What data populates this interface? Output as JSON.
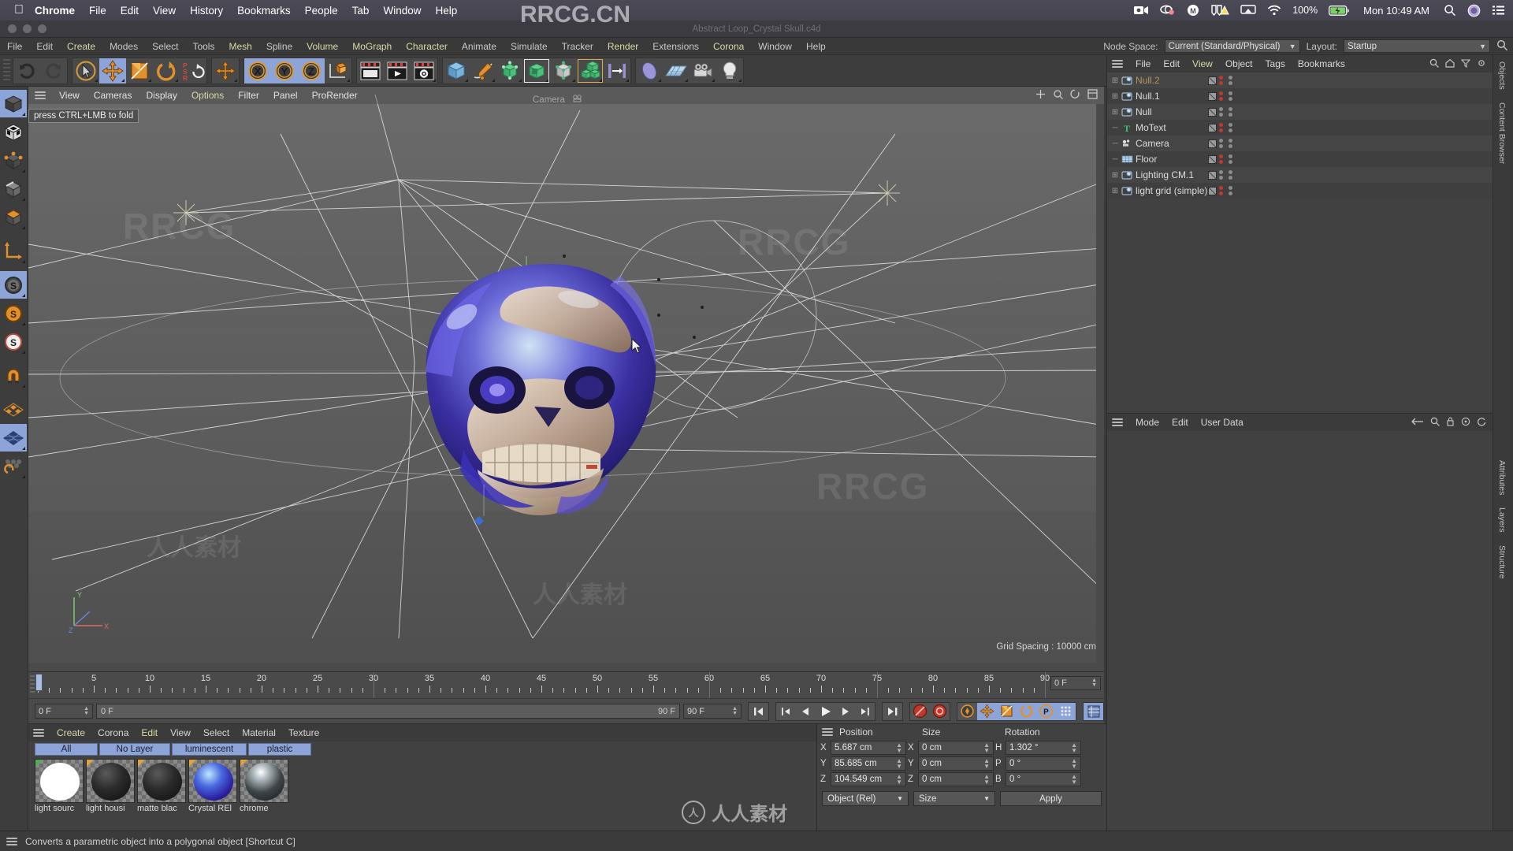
{
  "macos": {
    "app_name": "Chrome",
    "menus": [
      "Chrome",
      "File",
      "Edit",
      "View",
      "History",
      "Bookmarks",
      "People",
      "Tab",
      "Window",
      "Help"
    ],
    "battery_percent": "100%",
    "clock": "Mon 10:49 AM",
    "tray_icons": [
      "screen-record-icon",
      "dropbox-icon",
      "grammarly-icon",
      "display-warning-icon",
      "airplay-icon",
      "wifi-icon",
      "battery-icon",
      "search-icon",
      "siri-icon",
      "control-center-icon"
    ]
  },
  "window": {
    "title": "Abstract Loop_Crystal Skull.c4d"
  },
  "c4d_menu": {
    "items": [
      "File",
      "Edit",
      "Create",
      "Modes",
      "Select",
      "Tools",
      "Mesh",
      "Spline",
      "Volume",
      "MoGraph",
      "Character",
      "Animate",
      "Simulate",
      "Tracker",
      "Render",
      "Extensions",
      "Corona",
      "Window",
      "Help"
    ],
    "node_space_label": "Node Space:",
    "node_space_value": "Current (Standard/Physical)",
    "layout_label": "Layout:",
    "layout_value": "Startup"
  },
  "toolbar": {
    "groups": [
      {
        "name": "undo-redo",
        "buttons": [
          "undo-icon",
          "redo-icon"
        ]
      },
      {
        "name": "transform",
        "buttons": [
          "selection-icon",
          "move-icon",
          "scale-icon",
          "rotate-icon",
          "psr-icon"
        ]
      },
      {
        "name": "world-object",
        "buttons": [
          "world-object-axis-icon"
        ]
      },
      {
        "name": "axis-lock",
        "buttons": [
          "lock-x-icon",
          "lock-y-icon",
          "lock-z-icon",
          "world-coord-icon"
        ]
      },
      {
        "name": "render",
        "buttons": [
          "render-view-icon",
          "render-queue-icon",
          "render-settings-icon"
        ]
      },
      {
        "name": "create",
        "buttons": [
          "cube-icon",
          "spline-pen-icon",
          "nurbs-icon",
          "modeling-object-icon",
          "deformer-icon",
          "array-icon",
          "scene-icon"
        ]
      },
      {
        "name": "scene",
        "buttons": [
          "field-icon",
          "floor-icon",
          "camera-icon",
          "light-icon"
        ]
      }
    ]
  },
  "left_palette": {
    "tools": [
      "model-mode-icon",
      "texture-mode-icon",
      "points-mode-icon",
      "edges-mode-icon",
      "polygons-mode-icon",
      "axis-mode-icon",
      "enable-axis-icon",
      "snap-gray-icon",
      "snap-orange-icon",
      "snap-white-icon",
      "magnet-icon",
      "workplane-icon",
      "grid-lock-icon",
      "quantize-icon"
    ]
  },
  "viewport": {
    "menu": [
      "View",
      "Cameras",
      "Display",
      "Options",
      "Filter",
      "Panel",
      "ProRender"
    ],
    "tooltip": "press CTRL+LMB to fold",
    "camera_label": "Camera",
    "grid_spacing": "Grid Spacing : 10000 cm",
    "axis_labels": {
      "x": "X",
      "y": "Y",
      "z": "Z"
    }
  },
  "object_manager": {
    "menu": [
      "File",
      "Edit",
      "View",
      "Object",
      "Tags",
      "Bookmarks"
    ],
    "menu_highlight": "View",
    "objects": [
      {
        "name": "Null.2",
        "icon": "null-icon",
        "expandable": true,
        "dimmed": true,
        "tag_colors": [
          "#c0392b",
          "#c0392b"
        ]
      },
      {
        "name": "Null.1",
        "icon": "null-icon",
        "expandable": true,
        "dimmed": false,
        "tag_colors": [
          "#c0392b",
          "#c0392b"
        ]
      },
      {
        "name": "Null",
        "icon": "null-icon",
        "expandable": true,
        "dimmed": false,
        "tag_colors": [
          "#8c8c8c",
          "#8c8c8c"
        ]
      },
      {
        "name": "MoText",
        "icon": "motext-icon",
        "expandable": false,
        "dimmed": false,
        "tag_colors": [
          "#c0392b",
          "#c0392b"
        ]
      },
      {
        "name": "Camera",
        "icon": "camera-icon",
        "expandable": false,
        "dimmed": false,
        "tag_colors": [
          "#8c8c8c",
          "#8c8c8c"
        ]
      },
      {
        "name": "Floor",
        "icon": "floor-icon",
        "expandable": false,
        "dimmed": false,
        "tag_colors": [
          "#c0392b",
          "#c0392b"
        ]
      },
      {
        "name": "Lighting CM.1",
        "icon": "null-icon",
        "expandable": true,
        "dimmed": false,
        "tag_colors": [
          "#8c8c8c",
          "#8c8c8c"
        ]
      },
      {
        "name": "light grid (simple)",
        "icon": "null-icon",
        "expandable": true,
        "dimmed": false,
        "tag_colors": [
          "#c0392b",
          "#c0392b"
        ]
      }
    ]
  },
  "attribute_manager": {
    "menu": [
      "Mode",
      "Edit",
      "User Data"
    ]
  },
  "right_tabs": [
    "Objects",
    "Content Browser",
    "Attributes",
    "Layers",
    "Structure"
  ],
  "timeline": {
    "start_label": "0 F",
    "ticks": [
      0,
      5,
      10,
      15,
      20,
      25,
      30,
      35,
      40,
      45,
      50,
      55,
      60,
      65,
      70,
      75,
      80,
      85,
      90
    ],
    "current_frame_field": "0 F",
    "range_start": "0 F",
    "range_end": "90 F",
    "range_end_field": "90 F",
    "transport_buttons": [
      "goto-start-icon",
      "prev-key-icon",
      "prev-frame-icon",
      "play-icon",
      "next-frame-icon",
      "next-key-icon",
      "goto-end-icon"
    ],
    "record_buttons": [
      "record-icon",
      "autokey-icon"
    ],
    "key_buttons": [
      "keyframe-selection-icon",
      "position-key-icon",
      "scale-key-icon",
      "rotation-key-icon",
      "param-key-icon",
      "pla-key-icon",
      "timeline-icon"
    ]
  },
  "material_manager": {
    "menu": [
      "Create",
      "Corona",
      "Edit",
      "View",
      "Select",
      "Material",
      "Texture"
    ],
    "layers": [
      "All",
      "No Layer",
      "luminescent",
      "plastic"
    ],
    "materials": [
      {
        "name": "light sourc",
        "swatch": "#ffffff",
        "flag": "#4caf50"
      },
      {
        "name": "light housi",
        "swatch": "#1e1e1e",
        "flag": "#e2a33c"
      },
      {
        "name": "matte blac",
        "swatch": "#262626",
        "flag": "#e2a33c"
      },
      {
        "name": "Crystal REl",
        "swatch": "#3a45c8",
        "flag": "#e2a33c"
      },
      {
        "name": "chrome",
        "swatch": "#404448",
        "flag": "#e2a33c"
      }
    ]
  },
  "coordinates": {
    "headers": [
      "Position",
      "Size",
      "Rotation"
    ],
    "rows": [
      {
        "pos_label": "X",
        "pos_value": "5.687 cm",
        "size_label": "X",
        "size_value": "0 cm",
        "rot_label": "H",
        "rot_value": "1.302 °"
      },
      {
        "pos_label": "Y",
        "pos_value": "85.685 cm",
        "size_label": "Y",
        "size_value": "0 cm",
        "rot_label": "P",
        "rot_value": "0 °"
      },
      {
        "pos_label": "Z",
        "pos_value": "104.549 cm",
        "size_label": "Z",
        "size_value": "0 cm",
        "rot_label": "B",
        "rot_value": "0 °"
      }
    ],
    "mode_dropdown": "Object (Rel)",
    "size_dropdown": "Size",
    "apply_button": "Apply"
  },
  "status_bar": {
    "message": "Converts a parametric object into a polygonal object [Shortcut C]"
  },
  "watermarks": {
    "text_main": "RRCG.CN",
    "text_repeat": "RRCG",
    "logo_text": "人人素材",
    "logo_mark": "人"
  },
  "colors": {
    "accent_blue": "#8da4d8",
    "menu_yellow": "#d9d9a8",
    "panel_bg": "#414141",
    "toolbar_bg": "#3d3d3d",
    "viewport_bg": "#5a5a5a",
    "tag_red": "#c0392b"
  }
}
